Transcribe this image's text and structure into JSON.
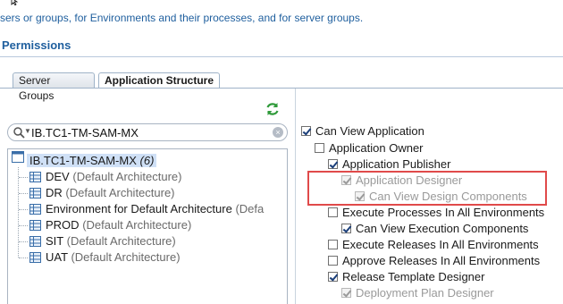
{
  "top_description": "sers or groups, for Environments and their processes, and for server groups.",
  "section_title": "Permissions",
  "tabs": [
    {
      "label": "Server Groups",
      "active": false
    },
    {
      "label": "Application Structure",
      "active": true
    }
  ],
  "search": {
    "value": "IB.TC1-TM-SAM-MX",
    "clear_icon": "×"
  },
  "tree": {
    "root": {
      "label": "IB.TC1-TM-SAM-MX",
      "count": "(6)"
    },
    "children": [
      {
        "name": "DEV",
        "meta": "(Default Architecture)"
      },
      {
        "name": "DR",
        "meta": "(Default Architecture)"
      },
      {
        "name": "Environment for Default Architecture",
        "meta": "(Defa"
      },
      {
        "name": "PROD",
        "meta": "(Default Architecture)"
      },
      {
        "name": "SIT",
        "meta": "(Default Architecture)"
      },
      {
        "name": "UAT",
        "meta": "(Default Architecture)"
      }
    ]
  },
  "permissions": [
    {
      "label": "Can View Application",
      "checked": true,
      "disabled": false,
      "indent": 0
    },
    {
      "label": "Application Owner",
      "checked": false,
      "disabled": false,
      "indent": 1
    },
    {
      "label": "Application Publisher",
      "checked": true,
      "disabled": false,
      "indent": 2
    },
    {
      "label": "Application Designer",
      "checked": true,
      "disabled": true,
      "indent": 2
    },
    {
      "label": "Can View Design Components",
      "checked": true,
      "disabled": true,
      "indent": 3
    },
    {
      "label": "Execute Processes In All Environments",
      "checked": false,
      "disabled": false,
      "indent": 2
    },
    {
      "label": "Can View Execution Components",
      "checked": true,
      "disabled": false,
      "indent": 3
    },
    {
      "label": "Execute Releases In All Environments",
      "checked": false,
      "disabled": false,
      "indent": 2
    },
    {
      "label": "Approve Releases In All Environments",
      "checked": false,
      "disabled": false,
      "indent": 2
    },
    {
      "label": "Release Template Designer",
      "checked": true,
      "disabled": false,
      "indent": 2
    },
    {
      "label": "Deployment Plan Designer",
      "checked": true,
      "disabled": true,
      "indent": 3
    }
  ],
  "colors": {
    "accent": "#1f5f9e",
    "highlight_border": "#e04a4a",
    "selection": "#cfe0f6"
  },
  "icons": {
    "refresh": "refresh-icon",
    "search": "search-icon",
    "environment": "grid-icon",
    "application": "window-icon"
  }
}
